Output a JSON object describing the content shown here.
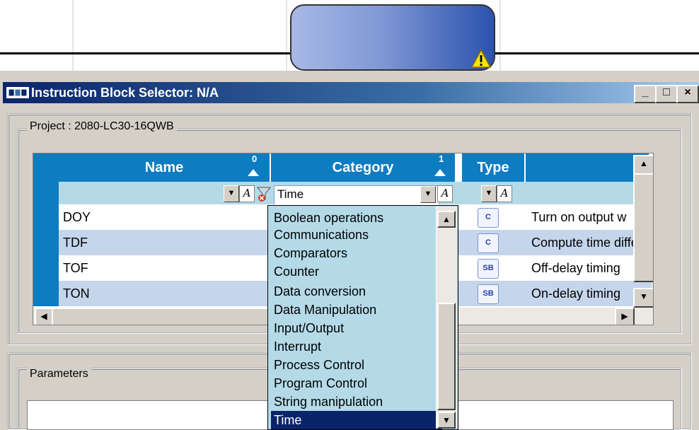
{
  "window": {
    "title": "Instruction Block Selector: N/A",
    "buttons": {
      "minimize": "_",
      "maximize": "□",
      "close": "×"
    }
  },
  "project": {
    "label": "Project : 2080-LC30-16QWB"
  },
  "grid": {
    "columns": [
      {
        "label": "Name",
        "sort_index": "0"
      },
      {
        "label": "Category",
        "sort_index": "1"
      },
      {
        "label": "Type"
      },
      {
        "label": ""
      }
    ],
    "filter": {
      "name_value": "",
      "category_value": "Time",
      "type_value": ""
    },
    "rows": [
      {
        "name": "DOY",
        "type_icon": "C",
        "description": "Turn on output w"
      },
      {
        "name": "TDF",
        "type_icon": "C",
        "description": "Compute time diffe"
      },
      {
        "name": "TOF",
        "type_icon": "SB",
        "description": "Off-delay timing"
      },
      {
        "name": "TON",
        "type_icon": "SB",
        "description": "On-delay timing"
      }
    ]
  },
  "category_dropdown": {
    "options": [
      "Boolean operations",
      "Communications",
      "Comparators",
      "Counter",
      "Data conversion",
      "Data Manipulation",
      "Input/Output",
      "Interrupt",
      "Process Control",
      "Program Control",
      "String manipulation",
      "Time"
    ],
    "selected": "Time"
  },
  "parameters": {
    "label": "Parameters"
  },
  "colors": {
    "header_blue": "#0d7cc1",
    "filter_row": "#b4dae8",
    "selection": "#0a246a",
    "window_face": "#d4d0c8"
  }
}
